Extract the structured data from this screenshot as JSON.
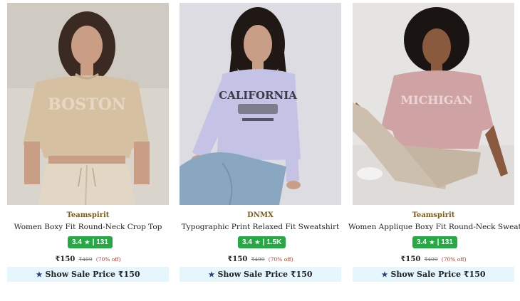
{
  "products": [
    {
      "brand": "Teamspirit",
      "title": "Women Boxy Fit Round-Neck Crop Top",
      "rating": "3.4",
      "reviews": "131",
      "price": "₹150",
      "mrp": "₹499",
      "discount": "(70% off)",
      "sale_label": "Show Sale Price ₹150",
      "print_text": "BOSTON",
      "colors": {
        "bg": "#d9d4cc",
        "shirt": "#d6c0a2",
        "pants": "#e2d6c4",
        "skin": "#c99e84",
        "hair": "#3b2a22"
      }
    },
    {
      "brand": "DNMX",
      "title": "Typographic Print Relaxed Fit Sweatshirt",
      "rating": "3.4",
      "reviews": "1.5K",
      "price": "₹150",
      "mrp": "₹499",
      "discount": "(70% off)",
      "sale_label": "Show Sale Price ₹150",
      "print_text": "CALIFORNIA",
      "colors": {
        "bg": "#dcdce2",
        "shirt": "#c4c3e6",
        "pants": "#8aa7c2",
        "skin": "#c89e86",
        "hair": "#201814"
      }
    },
    {
      "brand": "Teamspirit",
      "title": "Women Applique Boxy Fit Round-Neck Sweatshirt",
      "rating": "3.4",
      "reviews": "131",
      "price": "₹150",
      "mrp": "₹499",
      "discount": "(70% off)",
      "sale_label": "Show Sale Price ₹150",
      "print_text": "MICHIGAN",
      "colors": {
        "bg": "#e6e4e2",
        "shirt": "#cfa3a3",
        "pants": "#cdbfae",
        "skin": "#8a5a3e",
        "hair": "#1a1412"
      }
    }
  ],
  "icons": {
    "rating": "star-icon",
    "sale": "star-icon"
  }
}
